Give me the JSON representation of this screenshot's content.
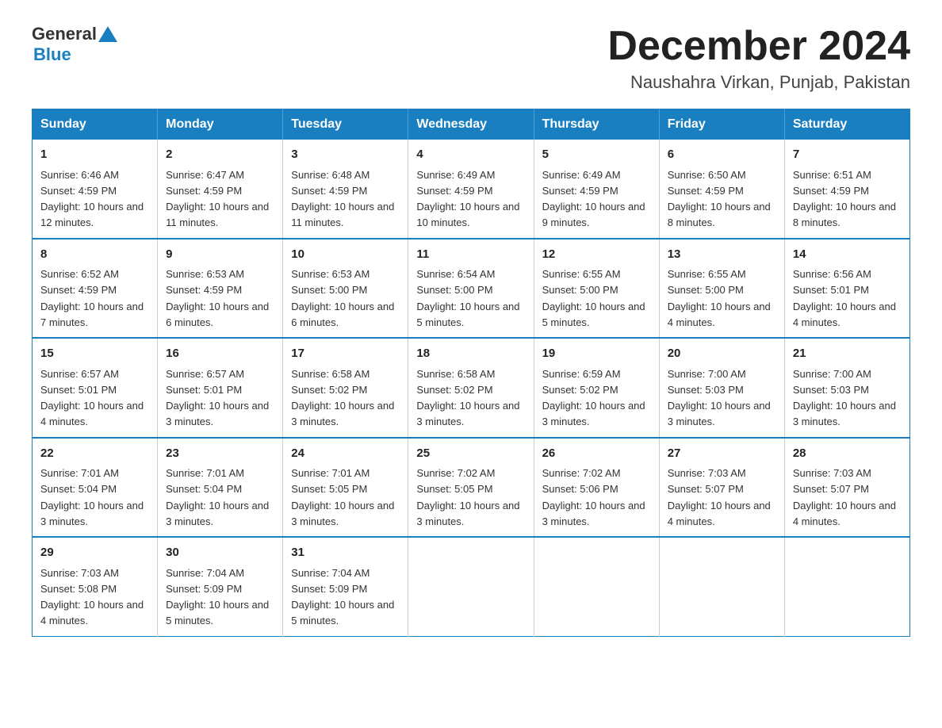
{
  "header": {
    "logo_general": "General",
    "logo_blue": "Blue",
    "month_title": "December 2024",
    "location": "Naushahra Virkan, Punjab, Pakistan"
  },
  "calendar": {
    "days_of_week": [
      "Sunday",
      "Monday",
      "Tuesday",
      "Wednesday",
      "Thursday",
      "Friday",
      "Saturday"
    ],
    "weeks": [
      [
        {
          "day": "1",
          "sunrise": "Sunrise: 6:46 AM",
          "sunset": "Sunset: 4:59 PM",
          "daylight": "Daylight: 10 hours and 12 minutes."
        },
        {
          "day": "2",
          "sunrise": "Sunrise: 6:47 AM",
          "sunset": "Sunset: 4:59 PM",
          "daylight": "Daylight: 10 hours and 11 minutes."
        },
        {
          "day": "3",
          "sunrise": "Sunrise: 6:48 AM",
          "sunset": "Sunset: 4:59 PM",
          "daylight": "Daylight: 10 hours and 11 minutes."
        },
        {
          "day": "4",
          "sunrise": "Sunrise: 6:49 AM",
          "sunset": "Sunset: 4:59 PM",
          "daylight": "Daylight: 10 hours and 10 minutes."
        },
        {
          "day": "5",
          "sunrise": "Sunrise: 6:49 AM",
          "sunset": "Sunset: 4:59 PM",
          "daylight": "Daylight: 10 hours and 9 minutes."
        },
        {
          "day": "6",
          "sunrise": "Sunrise: 6:50 AM",
          "sunset": "Sunset: 4:59 PM",
          "daylight": "Daylight: 10 hours and 8 minutes."
        },
        {
          "day": "7",
          "sunrise": "Sunrise: 6:51 AM",
          "sunset": "Sunset: 4:59 PM",
          "daylight": "Daylight: 10 hours and 8 minutes."
        }
      ],
      [
        {
          "day": "8",
          "sunrise": "Sunrise: 6:52 AM",
          "sunset": "Sunset: 4:59 PM",
          "daylight": "Daylight: 10 hours and 7 minutes."
        },
        {
          "day": "9",
          "sunrise": "Sunrise: 6:53 AM",
          "sunset": "Sunset: 4:59 PM",
          "daylight": "Daylight: 10 hours and 6 minutes."
        },
        {
          "day": "10",
          "sunrise": "Sunrise: 6:53 AM",
          "sunset": "Sunset: 5:00 PM",
          "daylight": "Daylight: 10 hours and 6 minutes."
        },
        {
          "day": "11",
          "sunrise": "Sunrise: 6:54 AM",
          "sunset": "Sunset: 5:00 PM",
          "daylight": "Daylight: 10 hours and 5 minutes."
        },
        {
          "day": "12",
          "sunrise": "Sunrise: 6:55 AM",
          "sunset": "Sunset: 5:00 PM",
          "daylight": "Daylight: 10 hours and 5 minutes."
        },
        {
          "day": "13",
          "sunrise": "Sunrise: 6:55 AM",
          "sunset": "Sunset: 5:00 PM",
          "daylight": "Daylight: 10 hours and 4 minutes."
        },
        {
          "day": "14",
          "sunrise": "Sunrise: 6:56 AM",
          "sunset": "Sunset: 5:01 PM",
          "daylight": "Daylight: 10 hours and 4 minutes."
        }
      ],
      [
        {
          "day": "15",
          "sunrise": "Sunrise: 6:57 AM",
          "sunset": "Sunset: 5:01 PM",
          "daylight": "Daylight: 10 hours and 4 minutes."
        },
        {
          "day": "16",
          "sunrise": "Sunrise: 6:57 AM",
          "sunset": "Sunset: 5:01 PM",
          "daylight": "Daylight: 10 hours and 3 minutes."
        },
        {
          "day": "17",
          "sunrise": "Sunrise: 6:58 AM",
          "sunset": "Sunset: 5:02 PM",
          "daylight": "Daylight: 10 hours and 3 minutes."
        },
        {
          "day": "18",
          "sunrise": "Sunrise: 6:58 AM",
          "sunset": "Sunset: 5:02 PM",
          "daylight": "Daylight: 10 hours and 3 minutes."
        },
        {
          "day": "19",
          "sunrise": "Sunrise: 6:59 AM",
          "sunset": "Sunset: 5:02 PM",
          "daylight": "Daylight: 10 hours and 3 minutes."
        },
        {
          "day": "20",
          "sunrise": "Sunrise: 7:00 AM",
          "sunset": "Sunset: 5:03 PM",
          "daylight": "Daylight: 10 hours and 3 minutes."
        },
        {
          "day": "21",
          "sunrise": "Sunrise: 7:00 AM",
          "sunset": "Sunset: 5:03 PM",
          "daylight": "Daylight: 10 hours and 3 minutes."
        }
      ],
      [
        {
          "day": "22",
          "sunrise": "Sunrise: 7:01 AM",
          "sunset": "Sunset: 5:04 PM",
          "daylight": "Daylight: 10 hours and 3 minutes."
        },
        {
          "day": "23",
          "sunrise": "Sunrise: 7:01 AM",
          "sunset": "Sunset: 5:04 PM",
          "daylight": "Daylight: 10 hours and 3 minutes."
        },
        {
          "day": "24",
          "sunrise": "Sunrise: 7:01 AM",
          "sunset": "Sunset: 5:05 PM",
          "daylight": "Daylight: 10 hours and 3 minutes."
        },
        {
          "day": "25",
          "sunrise": "Sunrise: 7:02 AM",
          "sunset": "Sunset: 5:05 PM",
          "daylight": "Daylight: 10 hours and 3 minutes."
        },
        {
          "day": "26",
          "sunrise": "Sunrise: 7:02 AM",
          "sunset": "Sunset: 5:06 PM",
          "daylight": "Daylight: 10 hours and 3 minutes."
        },
        {
          "day": "27",
          "sunrise": "Sunrise: 7:03 AM",
          "sunset": "Sunset: 5:07 PM",
          "daylight": "Daylight: 10 hours and 4 minutes."
        },
        {
          "day": "28",
          "sunrise": "Sunrise: 7:03 AM",
          "sunset": "Sunset: 5:07 PM",
          "daylight": "Daylight: 10 hours and 4 minutes."
        }
      ],
      [
        {
          "day": "29",
          "sunrise": "Sunrise: 7:03 AM",
          "sunset": "Sunset: 5:08 PM",
          "daylight": "Daylight: 10 hours and 4 minutes."
        },
        {
          "day": "30",
          "sunrise": "Sunrise: 7:04 AM",
          "sunset": "Sunset: 5:09 PM",
          "daylight": "Daylight: 10 hours and 5 minutes."
        },
        {
          "day": "31",
          "sunrise": "Sunrise: 7:04 AM",
          "sunset": "Sunset: 5:09 PM",
          "daylight": "Daylight: 10 hours and 5 minutes."
        },
        null,
        null,
        null,
        null
      ]
    ]
  }
}
